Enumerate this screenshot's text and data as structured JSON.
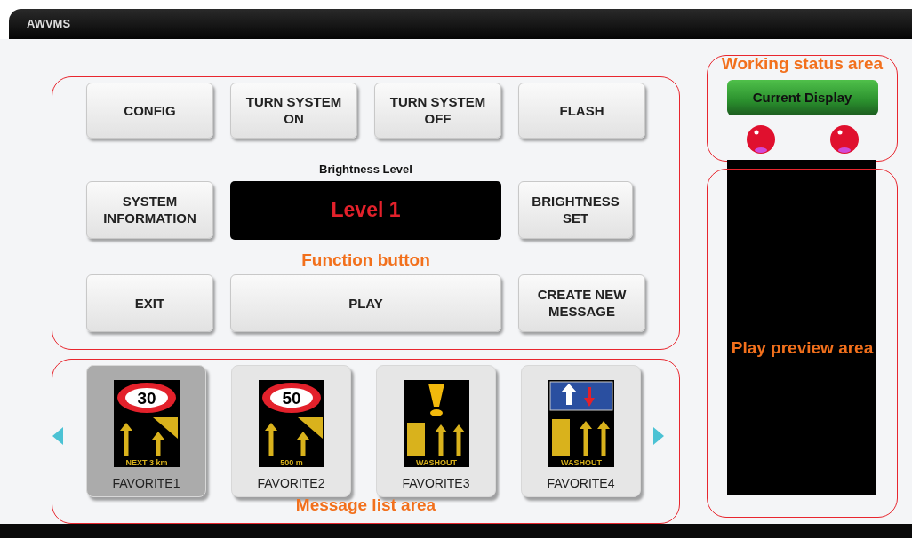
{
  "window": {
    "title": "AWVMS"
  },
  "function_panel": {
    "annotation": "Function button",
    "buttons": [
      {
        "label": "CONFIG",
        "kind": "normal"
      },
      {
        "label": "TURN SYSTEM ON",
        "kind": "normal"
      },
      {
        "label": "TURN SYSTEM OFF",
        "kind": "normal"
      },
      {
        "label": "FLASH",
        "kind": "normal"
      },
      {
        "label": "SYSTEM INFORMATION",
        "kind": "normal"
      },
      {
        "label": "BRIGHTNESS SET",
        "kind": "narrow"
      },
      {
        "label": "EXIT",
        "kind": "normal"
      },
      {
        "label": "PLAY",
        "kind": "wide"
      },
      {
        "label": "CREATE NEW MESSAGE",
        "kind": "normal"
      }
    ],
    "brightness": {
      "label": "Brightness Level",
      "value": "Level 1"
    }
  },
  "message_list": {
    "annotation": "Message list area",
    "favorites": [
      {
        "label": "FAVORITE1",
        "selected": true,
        "sign": {
          "kind": "speed",
          "number": "30",
          "caption": "NEXT 3 km"
        }
      },
      {
        "label": "FAVORITE2",
        "selected": false,
        "sign": {
          "kind": "speed",
          "number": "50",
          "caption": "500 m"
        }
      },
      {
        "label": "FAVORITE3",
        "selected": false,
        "sign": {
          "kind": "warning",
          "caption": "WASHOUT"
        }
      },
      {
        "label": "FAVORITE4",
        "selected": false,
        "sign": {
          "kind": "priority",
          "caption": "WASHOUT"
        }
      }
    ]
  },
  "status_panel": {
    "annotation": "Working status area",
    "button": "Current Display"
  },
  "preview_panel": {
    "annotation": "Play preview area"
  }
}
